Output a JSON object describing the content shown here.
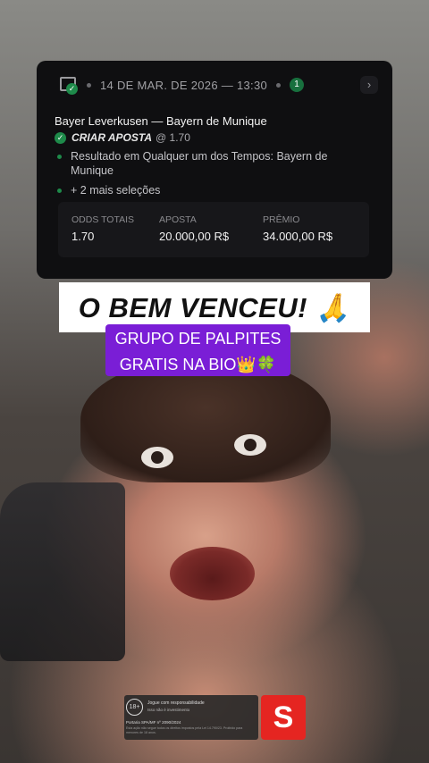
{
  "bet_card": {
    "date": "14 DE MAR. DE 2026 — 13:30",
    "selection_count": "1",
    "match": "Bayer Leverkusen — Bayern de Munique",
    "criar_label": "CRIAR APOSTA",
    "criar_odds": "@ 1.70",
    "selection": "Resultado em Qualquer um dos Tempos: Bayern de Munique",
    "more_selections": "+ 2 mais seleções",
    "summary": {
      "odds_label": "ODDS TOTAIS",
      "odds_value": "1.70",
      "stake_label": "APOSTA",
      "stake_value": "20.000,00 R$",
      "prize_label": "PRÊMIO",
      "prize_value": "34.000,00 R$"
    }
  },
  "overlay": {
    "headline": "O BEM VENCEU! 🙏",
    "promo_line1": "GRUPO DE PALPITES",
    "promo_line2": "GRATIS NA BIO👑🍀"
  },
  "footer": {
    "age": "18+",
    "line1": "Jogue com responsabilidade",
    "line2": "Isso não é investimento",
    "line3": "Portaria SPA/MF nº 2090/2024",
    "line4": "Esta ação não segue todos os direitos impostos pela Lei 14.790/23. Proibido para menores de 18 anos.",
    "logo": "S"
  },
  "colors": {
    "accent_green": "#1e8a4a",
    "promo_purple": "#7a1ed6",
    "logo_red": "#e52521"
  }
}
